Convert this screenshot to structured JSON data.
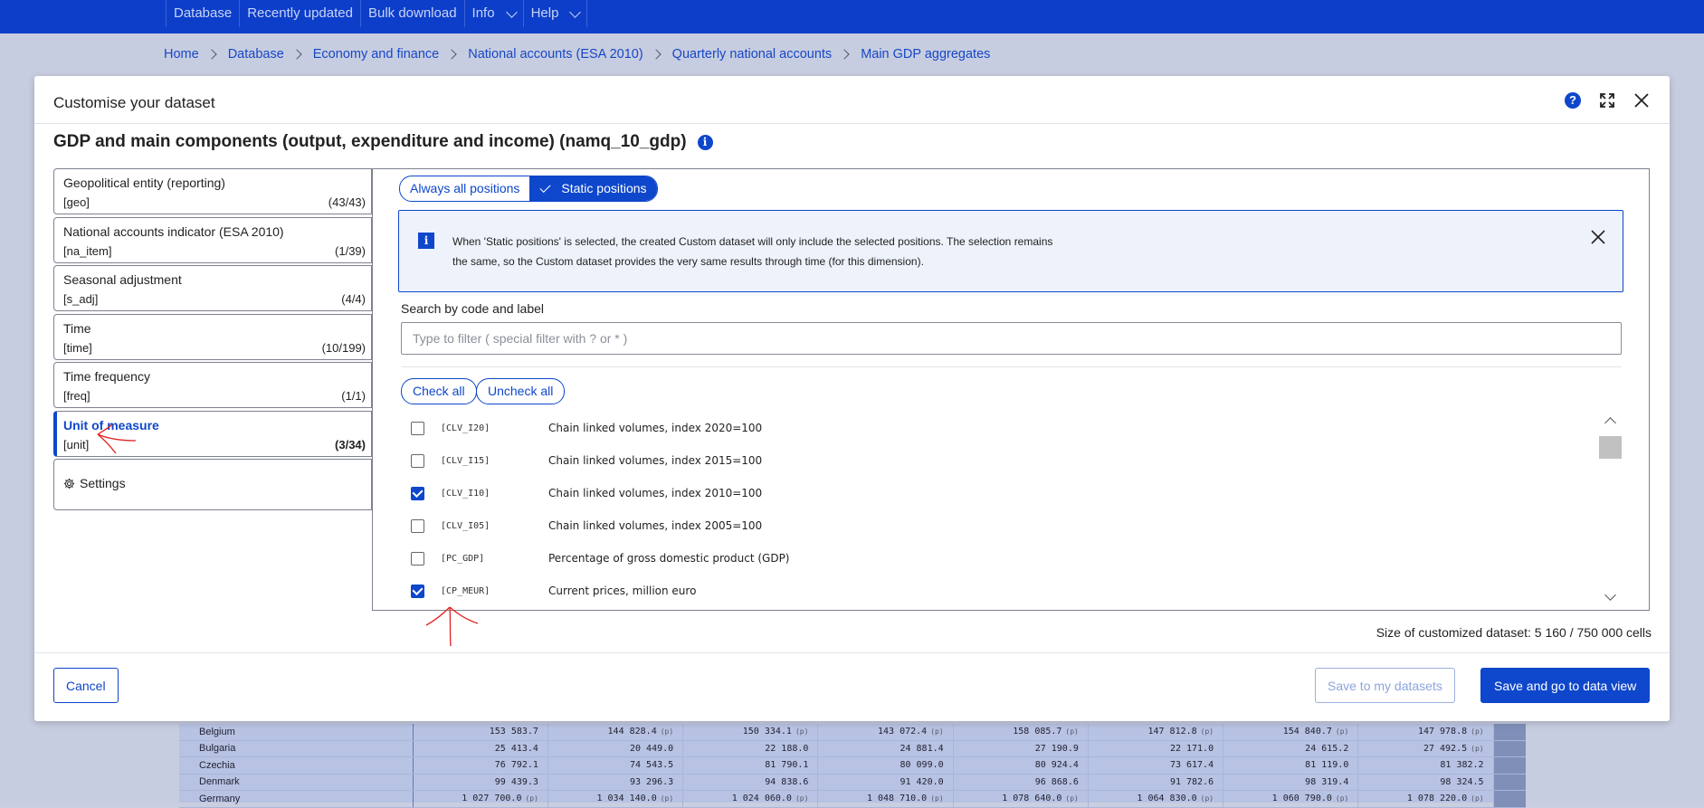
{
  "topnav": {
    "items": [
      {
        "label": "Database"
      },
      {
        "label": "Recently updated"
      },
      {
        "label": "Bulk download"
      },
      {
        "label": "Info"
      },
      {
        "label": "Help"
      }
    ]
  },
  "breadcrumb": [
    "Home",
    "Database",
    "Economy and finance",
    "National accounts (ESA 2010)",
    "Quarterly national accounts",
    "Main GDP aggregates"
  ],
  "modal": {
    "title": "Customise your dataset",
    "dataset_title": "GDP and main components (output, expenditure and income) (namq_10_gdp)",
    "help_icon": "help-icon",
    "expand_icon": "expand-icon",
    "close_icon": "close-icon"
  },
  "dimensions": [
    {
      "label": "Geopolitical entity (reporting)",
      "code": "[geo]",
      "count": "(43/43)"
    },
    {
      "label": "National accounts indicator (ESA 2010)",
      "code": "[na_item]",
      "count": "(1/39)"
    },
    {
      "label": "Seasonal adjustment",
      "code": "[s_adj]",
      "count": "(4/4)"
    },
    {
      "label": "Time",
      "code": "[time]",
      "count": "(10/199)"
    },
    {
      "label": "Time frequency",
      "code": "[freq]",
      "count": "(1/1)"
    },
    {
      "label": "Unit of measure",
      "code": "[unit]",
      "count": "(3/34)",
      "active": true
    }
  ],
  "settings_label": "Settings",
  "positions_toggle": {
    "always": "Always all positions",
    "static": "Static positions",
    "selected": "static"
  },
  "info_message": "When 'Static positions' is selected, the created Custom dataset will only include the selected positions. The selection remains the same, so the Custom dataset provides the very same results through time (for this dimension).",
  "search": {
    "label": "Search by code and label",
    "placeholder": "Type to filter ( special filter with ? or * )",
    "value": ""
  },
  "check_all": "Check all",
  "uncheck_all": "Uncheck all",
  "unit_items": [
    {
      "code": "[CLV_I20]",
      "label": "Chain linked volumes, index 2020=100",
      "checked": false
    },
    {
      "code": "[CLV_I15]",
      "label": "Chain linked volumes, index 2015=100",
      "checked": false
    },
    {
      "code": "[CLV_I10]",
      "label": "Chain linked volumes, index 2010=100",
      "checked": true
    },
    {
      "code": "[CLV_I05]",
      "label": "Chain linked volumes, index 2005=100",
      "checked": false
    },
    {
      "code": "[PC_GDP]",
      "label": "Percentage of gross domestic product (GDP)",
      "checked": false
    },
    {
      "code": "[CP_MEUR]",
      "label": "Current prices, million euro",
      "checked": true
    }
  ],
  "size_info": "Size of customized dataset: 5 160 / 750 000 cells",
  "buttons": {
    "cancel": "Cancel",
    "save_mine": "Save to my datasets",
    "save_go": "Save and go to data view"
  },
  "background_table": {
    "rows": [
      {
        "country": "Belgium",
        "values": [
          "153 583.7",
          "144 828.4",
          "150 334.1",
          "143 072.4",
          "158 085.7",
          "147 812.8",
          "154 840.7",
          "147 978.8"
        ]
      },
      {
        "country": "Bulgaria",
        "values": [
          "25 413.4",
          "20 449.0",
          "22 188.0",
          "24 881.4",
          "27 190.9",
          "22 171.0",
          "24 615.2",
          "27 492.5"
        ]
      },
      {
        "country": "Czechia",
        "values": [
          "76 792.1",
          "74 543.5",
          "81 790.1",
          "80 099.0",
          "80 924.4",
          "73 617.4",
          "81 119.0",
          "81 382.2"
        ]
      },
      {
        "country": "Denmark",
        "values": [
          "99 439.3",
          "93 296.3",
          "94 838.6",
          "91 420.0",
          "96 868.6",
          "91 782.6",
          "98 319.4",
          "98 324.5"
        ]
      },
      {
        "country": "Germany",
        "values": [
          "1 027 700.0",
          "1 034 140.0",
          "1 024 060.0",
          "1 048 710.0",
          "1 078 640.0",
          "1 064 830.0",
          "1 060 790.0",
          "1 078 220.0"
        ]
      }
    ],
    "flag": "(p)"
  },
  "colors": {
    "brand": "#0e47cb",
    "topbar": "#0d3ec9",
    "annotation": "#e02020"
  }
}
